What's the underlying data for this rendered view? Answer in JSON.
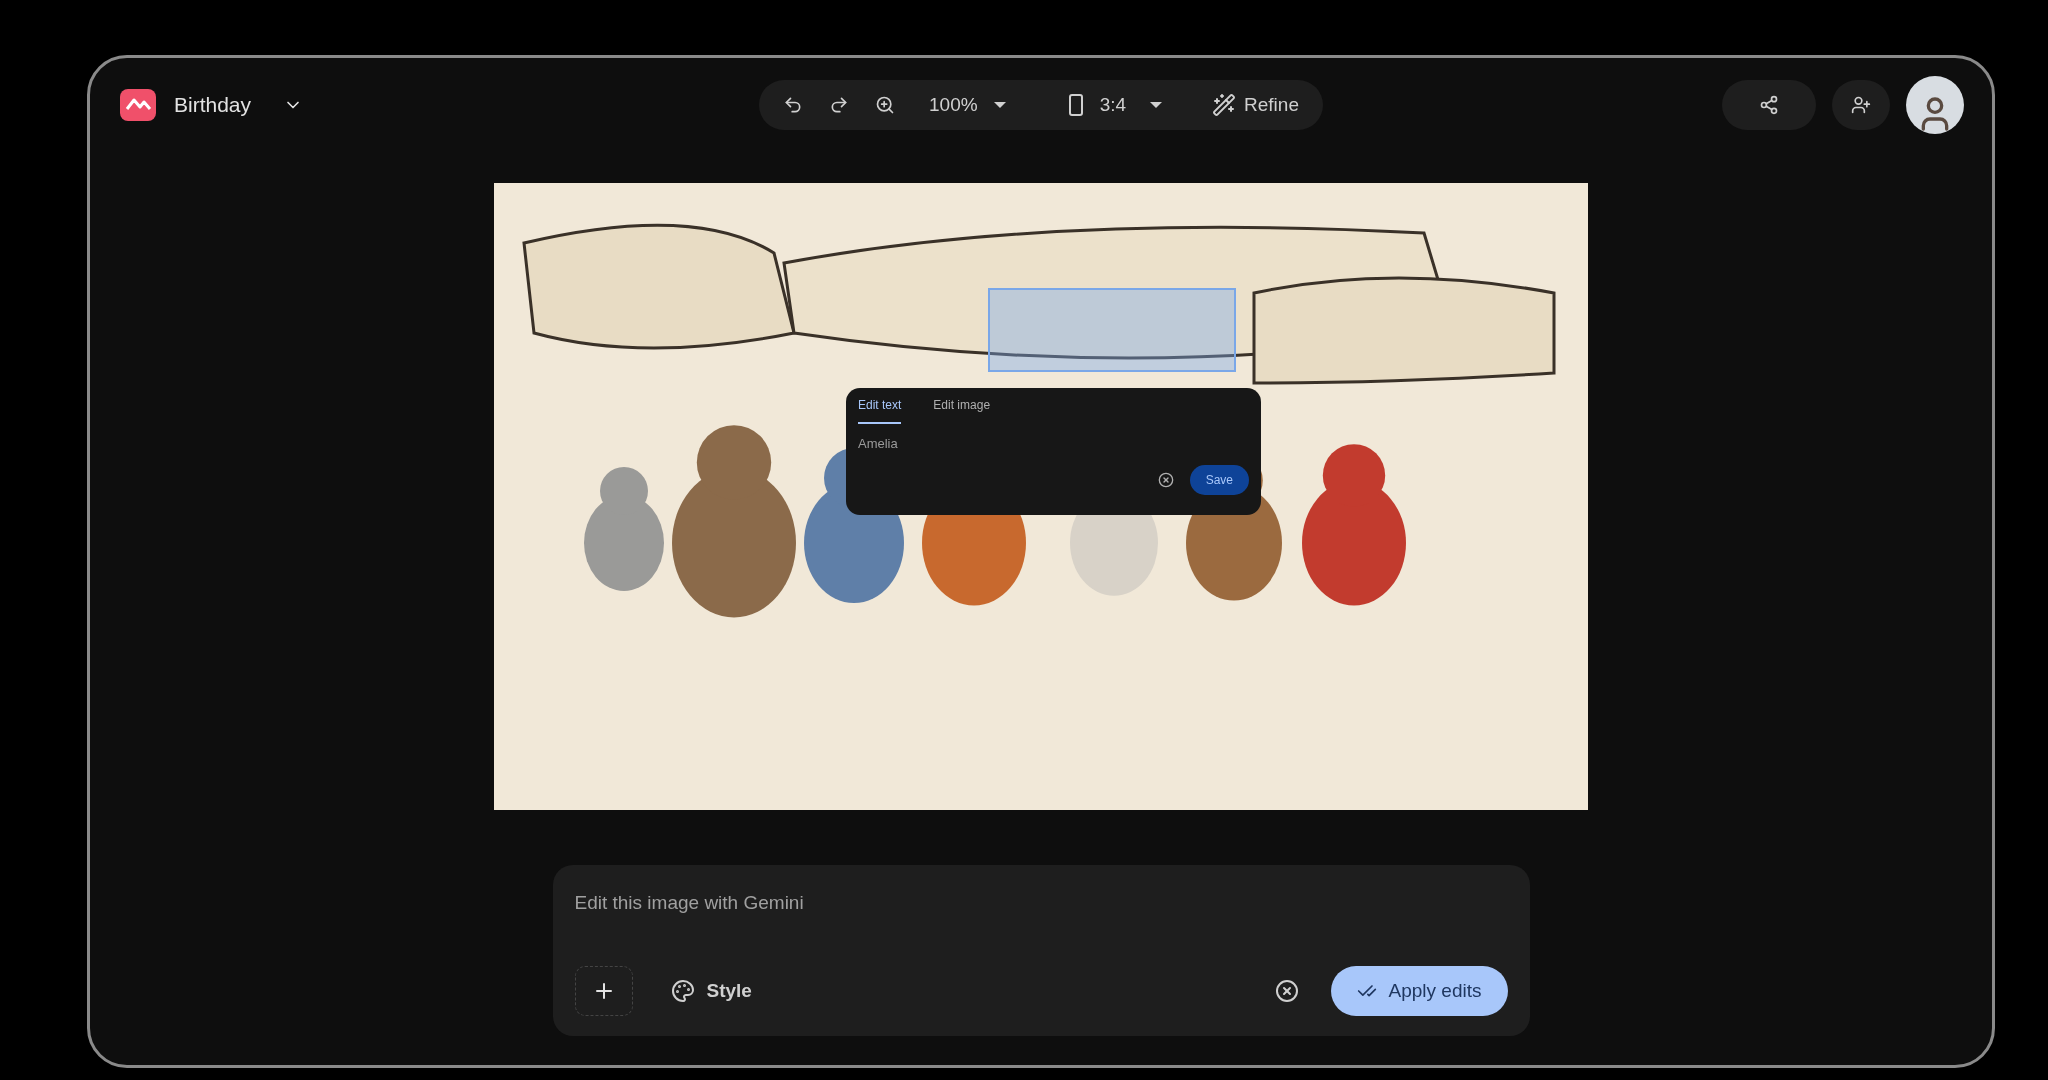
{
  "document": {
    "title": "Birthday"
  },
  "toolbar": {
    "zoom": "100%",
    "aspect_ratio": "3:4",
    "refine": "Refine"
  },
  "edit_popup": {
    "tabs": [
      {
        "label": "Edit text",
        "selected": true
      },
      {
        "label": "Edit image",
        "selected": false
      }
    ],
    "value": "Amelia",
    "save": "Save"
  },
  "prompt": {
    "placeholder": "Edit this image with Gemini",
    "style": "Style",
    "apply": "Apply edits"
  }
}
